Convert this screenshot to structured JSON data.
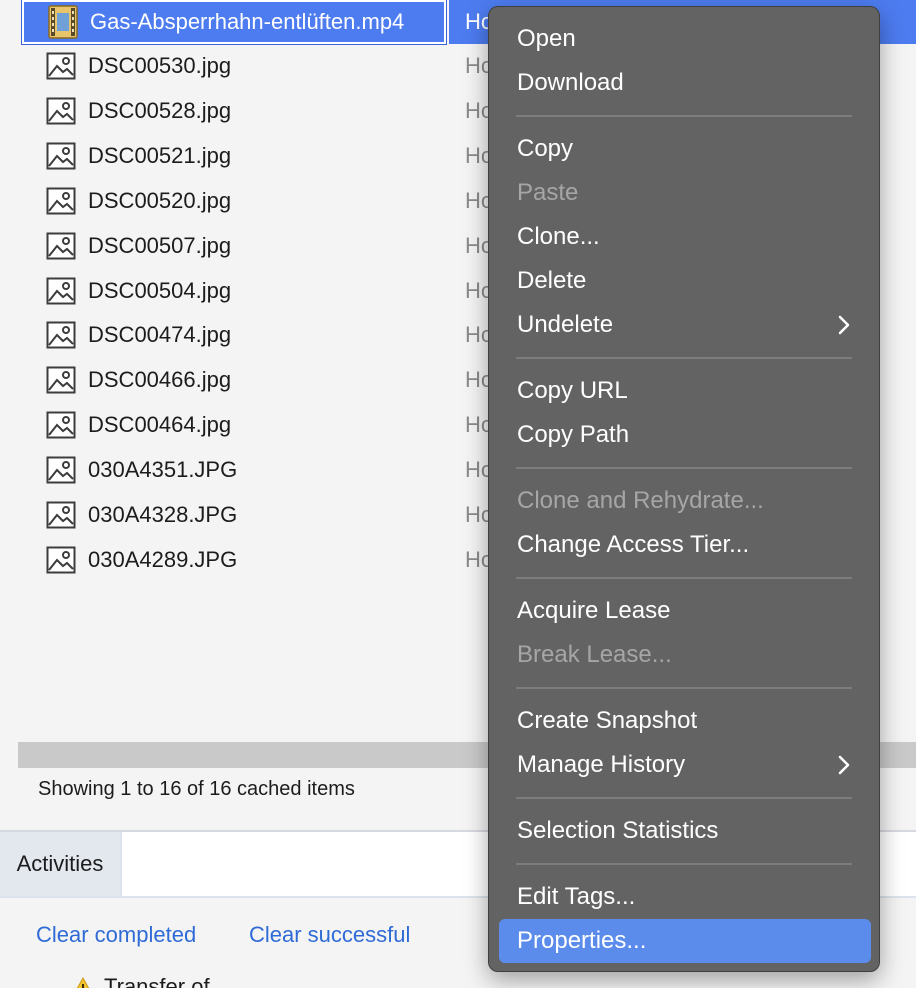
{
  "file_list": {
    "rows": [
      {
        "name": "Gas-Absperrhahn-entlüften.mp4",
        "col2": "Ho",
        "icon": "video-file-icon",
        "selected": true
      },
      {
        "name": "DSC00530.jpg",
        "col2": "Ho",
        "icon": "image-file-icon"
      },
      {
        "name": "DSC00528.jpg",
        "col2": "Ho",
        "icon": "image-file-icon"
      },
      {
        "name": "DSC00521.jpg",
        "col2": "Ho",
        "icon": "image-file-icon"
      },
      {
        "name": "DSC00520.jpg",
        "col2": "Ho",
        "icon": "image-file-icon"
      },
      {
        "name": "DSC00507.jpg",
        "col2": "Ho",
        "icon": "image-file-icon"
      },
      {
        "name": "DSC00504.jpg",
        "col2": "Ho",
        "icon": "image-file-icon"
      },
      {
        "name": "DSC00474.jpg",
        "col2": "Ho",
        "icon": "image-file-icon"
      },
      {
        "name": "DSC00466.jpg",
        "col2": "Ho",
        "icon": "image-file-icon"
      },
      {
        "name": "DSC00464.jpg",
        "col2": "Ho",
        "icon": "image-file-icon"
      },
      {
        "name": "030A4351.JPG",
        "col2": "Ho",
        "icon": "image-file-icon"
      },
      {
        "name": "030A4328.JPG",
        "col2": "Ho",
        "icon": "image-file-icon"
      },
      {
        "name": "030A4289.JPG",
        "col2": "Ho",
        "icon": "image-file-icon"
      }
    ],
    "status": "Showing 1 to 16 of 16 cached items"
  },
  "activities": {
    "tab_label": "Activities",
    "clear_completed": "Clear completed",
    "clear_successful": "Clear successful",
    "transfer_text": "Transfer of",
    "warning_icon": "warning-icon"
  },
  "context_menu": {
    "items": [
      {
        "label": "Open",
        "enabled": true
      },
      {
        "label": "Download",
        "enabled": true
      },
      {
        "separator": true
      },
      {
        "label": "Copy",
        "enabled": true
      },
      {
        "label": "Paste",
        "enabled": false
      },
      {
        "label": "Clone...",
        "enabled": true
      },
      {
        "label": "Delete",
        "enabled": true
      },
      {
        "label": "Undelete",
        "enabled": true,
        "submenu": true
      },
      {
        "separator": true
      },
      {
        "label": "Copy URL",
        "enabled": true
      },
      {
        "label": "Copy Path",
        "enabled": true
      },
      {
        "separator": true
      },
      {
        "label": "Clone and Rehydrate...",
        "enabled": false
      },
      {
        "label": "Change Access Tier...",
        "enabled": true
      },
      {
        "separator": true
      },
      {
        "label": "Acquire Lease",
        "enabled": true
      },
      {
        "label": "Break Lease...",
        "enabled": false
      },
      {
        "separator": true
      },
      {
        "label": "Create Snapshot",
        "enabled": true
      },
      {
        "label": "Manage History",
        "enabled": true,
        "submenu": true
      },
      {
        "separator": true
      },
      {
        "label": "Selection Statistics",
        "enabled": true
      },
      {
        "separator": true
      },
      {
        "label": "Edit Tags...",
        "enabled": true
      },
      {
        "label": "Properties...",
        "enabled": true,
        "highlighted": true
      }
    ]
  },
  "colors": {
    "selection": "#4d7cf0",
    "menu_bg": "#636363",
    "menu_highlight": "#5b8cec",
    "link": "#2f6bd6",
    "background": "#f4f4f4"
  }
}
